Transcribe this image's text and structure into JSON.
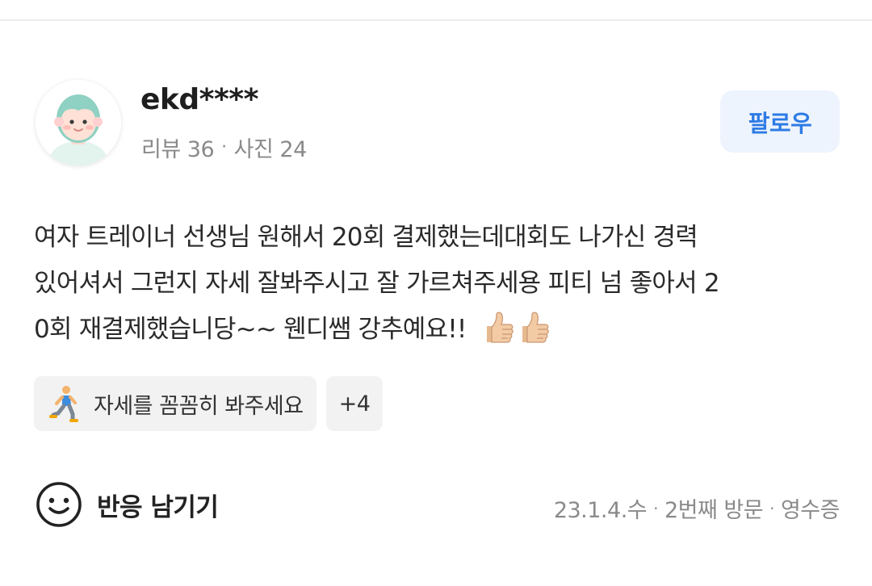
{
  "reviewer": {
    "name": "ekd****",
    "review_count": "리뷰 36",
    "photo_count": "사진 24",
    "stats_separator": "·"
  },
  "follow_button": {
    "label": "팔로우"
  },
  "review": {
    "lines": [
      "여자 트레이너 선생님 원해서 20회 결제했는데대회도 나가신 경력",
      "있어셔서 그런지 자세 잘봐주시고 잘 가르쳐주세용 피티 넘 좋아서 2",
      "0회 재결제했습니당~~ 웬디쌤 강추예요!!"
    ],
    "trailing_emoji": "thumbs-up-icon thumbs-up-icon"
  },
  "tags": {
    "primary": {
      "icon": "lunge-exercise-icon",
      "label": "자세를 꼼꼼히 봐주세요"
    },
    "more_label": "+4"
  },
  "footer": {
    "react_icon": "smiley-icon",
    "react_label": "반응 남기기",
    "date": "23.1.4.수",
    "visit": "2번째 방문",
    "verification": "영수증",
    "separator": "·"
  },
  "colors": {
    "accent_blue": "#2d7be5",
    "follow_bg": "#eef4fd",
    "muted_text": "#8a8a8a",
    "tag_bg": "#f2f2f2"
  }
}
